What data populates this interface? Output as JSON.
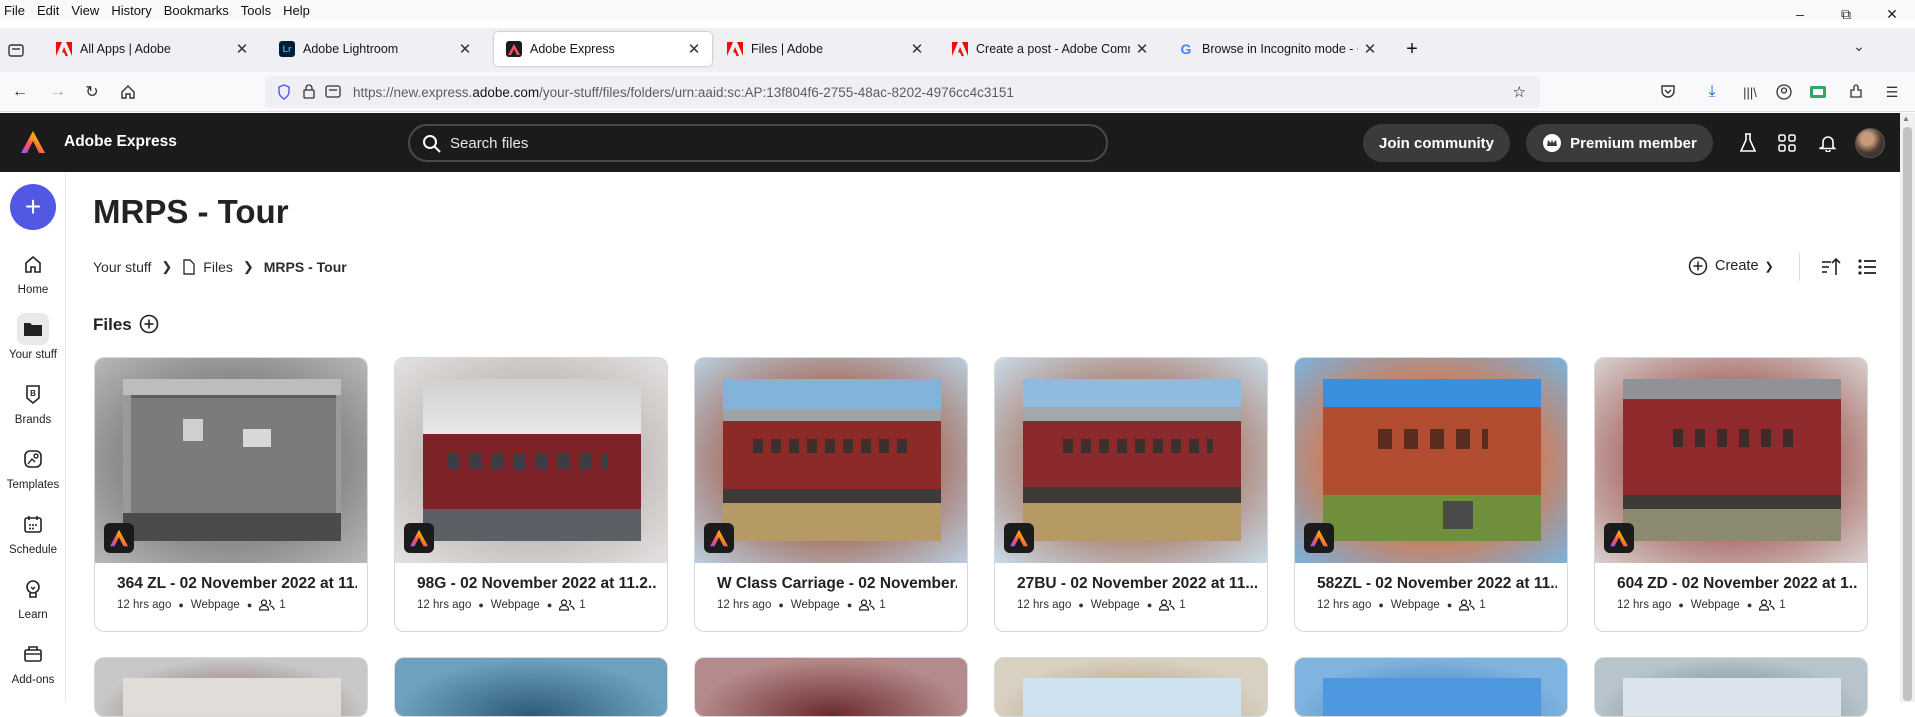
{
  "menu": [
    "File",
    "Edit",
    "View",
    "History",
    "Bookmarks",
    "Tools",
    "Help"
  ],
  "tabs": [
    {
      "label": "All Apps | Adobe",
      "icon": "adobe-icon"
    },
    {
      "label": "Adobe Lightroom",
      "icon": "lightroom-icon"
    },
    {
      "label": "Adobe Express",
      "icon": "adobe-express-icon"
    },
    {
      "label": "Files | Adobe",
      "icon": "adobe-icon"
    },
    {
      "label": "Create a post - Adobe Commun",
      "icon": "adobe-icon"
    },
    {
      "label": "Browse in Incognito mode - Co",
      "icon": "google-icon"
    }
  ],
  "url": {
    "prefix": "https://new.express.",
    "domain": "adobe.com",
    "path": "/your-stuff/files/folders/urn:aaid:sc:AP:13f804f6-2755-48ac-8202-4976cc4c3151"
  },
  "header": {
    "brand": "Adobe Express",
    "search_placeholder": "Search files",
    "join": "Join community",
    "premium": "Premium member"
  },
  "rail": [
    {
      "label": "Home",
      "icon": "home-icon"
    },
    {
      "label": "Your stuff",
      "icon": "folder-icon"
    },
    {
      "label": "Brands",
      "icon": "brands-icon"
    },
    {
      "label": "Templates",
      "icon": "templates-icon"
    },
    {
      "label": "Schedule",
      "icon": "calendar-icon"
    },
    {
      "label": "Learn",
      "icon": "learn-icon"
    },
    {
      "label": "Add-ons",
      "icon": "addons-icon"
    }
  ],
  "page": {
    "title": "MRPS - Tour",
    "breadcrumb": [
      "Your stuff",
      "Files",
      "MRPS - Tour"
    ],
    "create": "Create",
    "section": "Files"
  },
  "files": [
    {
      "title": "364 ZL - 02 November 2022 at 11...",
      "time": "12 hrs ago",
      "type": "Webpage",
      "collab": "1"
    },
    {
      "title": "98G - 02 November 2022 at 11.2...",
      "time": "12 hrs ago",
      "type": "Webpage",
      "collab": "1"
    },
    {
      "title": "W Class Carriage - 02 November...",
      "time": "12 hrs ago",
      "type": "Webpage",
      "collab": "1"
    },
    {
      "title": "27BU - 02 November 2022 at 11....",
      "time": "12 hrs ago",
      "type": "Webpage",
      "collab": "1"
    },
    {
      "title": "582ZL - 02 November 2022 at 11....",
      "time": "12 hrs ago",
      "type": "Webpage",
      "collab": "1"
    },
    {
      "title": "604 ZD - 02 November 2022 at 1...",
      "time": "12 hrs ago",
      "type": "Webpage",
      "collab": "1"
    }
  ],
  "colors": {
    "accent": "#5258e4",
    "header": "#1b1b1b",
    "pill": "#3b3b3b"
  }
}
